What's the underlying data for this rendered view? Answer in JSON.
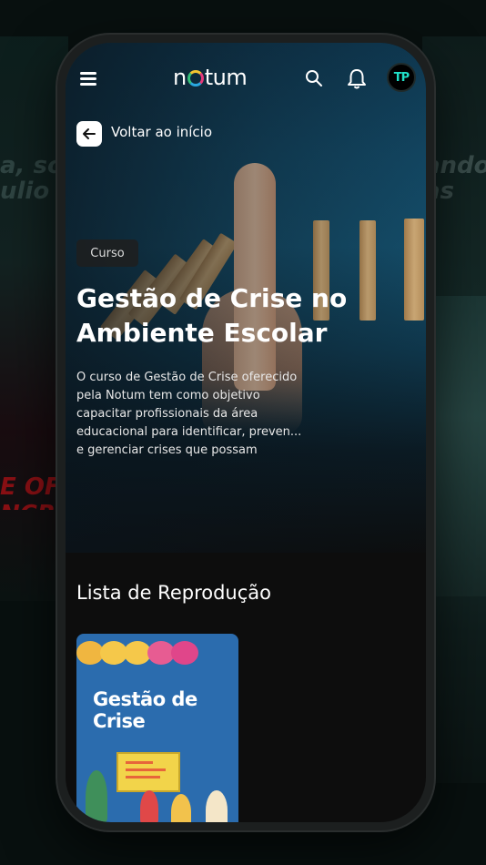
{
  "app": {
    "logo": "notum",
    "avatar_initials": "TP"
  },
  "header": {
    "menu_icon": "menu-icon",
    "search_icon": "search-icon",
    "notifications_icon": "bell-icon"
  },
  "nav": {
    "back_label": "Voltar ao início"
  },
  "course": {
    "badge": "Curso",
    "title": "Gestão de Crise no Ambiente Escolar",
    "description": "O curso de Gestão de Crise oferecido pela Notum tem como objetivo capacitar profissionais da área educacional para identificar, preven... e gerenciar crises que possam"
  },
  "playlist": {
    "section_title": "Lista de Reprodução",
    "items": [
      {
        "title": "Gestão de Crise"
      }
    ]
  },
  "colors": {
    "accent_blue": "#2b6cae",
    "background": "#0d0d0d",
    "avatar_text": "#20e0c8"
  }
}
